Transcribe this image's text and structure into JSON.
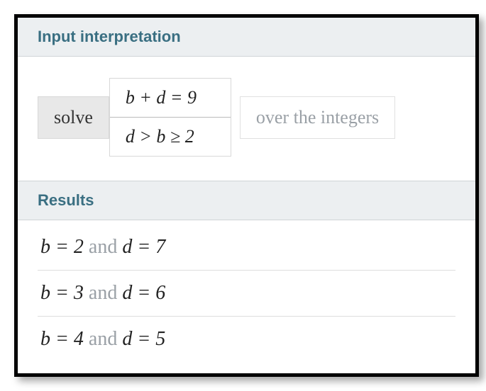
{
  "sections": {
    "interpretation_title": "Input interpretation",
    "results_title": "Results"
  },
  "input": {
    "action": "solve",
    "equation1": "b + d = 9",
    "equation2": "d > b ≥ 2",
    "domain": "over the integers"
  },
  "results": [
    {
      "lhs": "b = 2",
      "join": "and",
      "rhs": "d = 7"
    },
    {
      "lhs": "b = 3",
      "join": "and",
      "rhs": "d = 6"
    },
    {
      "lhs": "b = 4",
      "join": "and",
      "rhs": "d = 5"
    }
  ]
}
